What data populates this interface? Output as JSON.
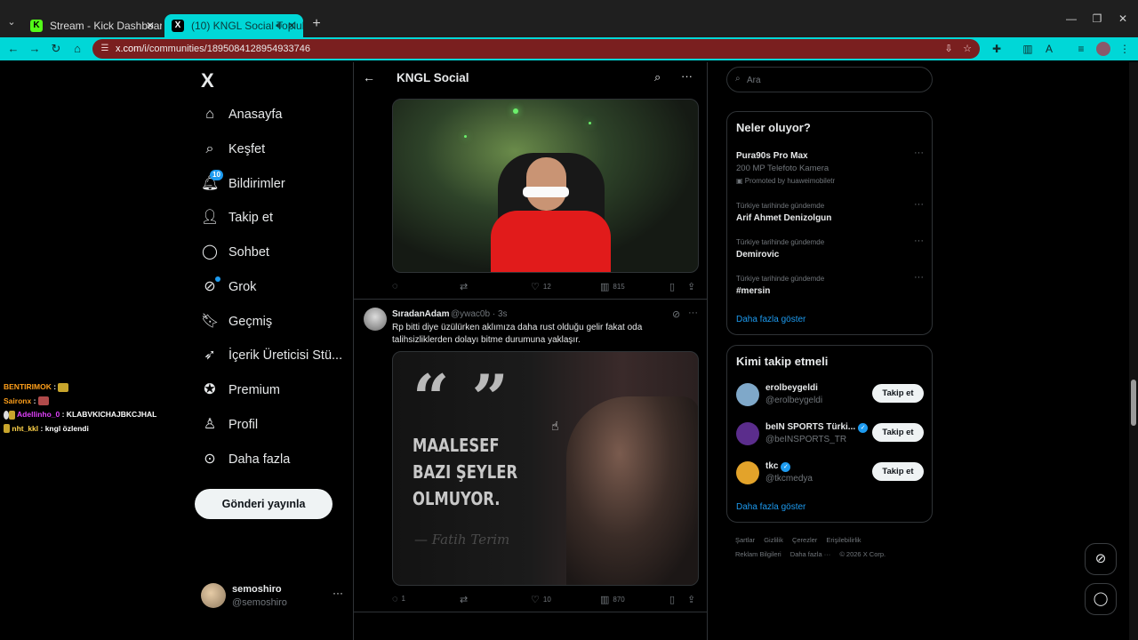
{
  "browser": {
    "tabs": [
      {
        "title": "Stream - Kick Dashboard",
        "favicon": "K",
        "active": false
      },
      {
        "title": "(10) KNGL Social Topluluk",
        "favicon": "X",
        "active": true
      }
    ],
    "url_host": "x.com",
    "url_path": "/i/communities/1895084128954933746"
  },
  "nav": {
    "logo": "X",
    "items": [
      {
        "label": "Anasayfa",
        "icon": "home-icon"
      },
      {
        "label": "Keşfet",
        "icon": "search-icon"
      },
      {
        "label": "Bildirimler",
        "icon": "bell-icon",
        "badge": "10"
      },
      {
        "label": "Takip et",
        "icon": "add-person-icon"
      },
      {
        "label": "Sohbet",
        "icon": "chat-icon"
      },
      {
        "label": "Grok",
        "icon": "grok-icon"
      },
      {
        "label": "Geçmiş",
        "icon": "bookmark-icon"
      },
      {
        "label": "İçerik Üreticisi Stü...",
        "icon": "rocket-icon"
      },
      {
        "label": "Premium",
        "icon": "premium-icon"
      },
      {
        "label": "Profil",
        "icon": "person-icon"
      },
      {
        "label": "Daha fazla",
        "icon": "more-circle-icon"
      }
    ],
    "post_button": "Gönderi yayınla",
    "account": {
      "name": "semoshiro",
      "handle": "@semoshiro"
    }
  },
  "chat_overlay": [
    {
      "user": "BENTIRIMOK",
      "msg": ":",
      "color": "#ff9f1a"
    },
    {
      "user": "Saironx",
      "msg": ":",
      "color": "#ff9f1a"
    },
    {
      "user": "Adellinho_0",
      "msg": ": KLABVKICHAJBKCJHAL",
      "color": "#e040fb"
    },
    {
      "user": "nht_kkl",
      "msg": ": kngl özlendi",
      "color": "#ffd24a"
    }
  ],
  "timeline": {
    "title": "KNGL Social",
    "tweet1": {
      "replies": "",
      "retweets": "",
      "likes": "12",
      "views": "815"
    },
    "tweet2": {
      "name": "SıradanAdam",
      "handle_time": "@ywac0b · 3s",
      "text": "Rp bitti diye üzülürken aklımıza daha rust olduğu gelir fakat oda talihsizliklerden dolayı bitme durumuna yaklaşır.",
      "image_text": {
        "quote": "“ ”",
        "lines": [
          "MAALESEF",
          "BAZI ŞEYLER",
          "OLMUYOR."
        ],
        "signature": "— Fatih Terim"
      },
      "replies": "1",
      "retweets": "",
      "likes": "10",
      "views": "870"
    }
  },
  "right": {
    "search_placeholder": "Ara",
    "trends_title": "Neler oluyor?",
    "trends": [
      {
        "title": "Pura90s Pro Max",
        "sub": "200 MP Telefoto Kamera",
        "promo": "Promoted by huaweimobiletr"
      },
      {
        "context": "Türkiye tarihinde gündemde",
        "title": "Arif Ahmet Denizolgun"
      },
      {
        "context": "Türkiye tarihinde gündemde",
        "title": "Demirovic"
      },
      {
        "context": "Türkiye tarihinde gündemde",
        "title": "#mersin"
      }
    ],
    "show_more": "Daha fazla göster",
    "wtf_title": "Kimi takip etmeli",
    "wtf": [
      {
        "name": "erolbeygeldi",
        "handle": "@erolbeygeldi",
        "verified": false,
        "avatar_color": "#7fa8c9"
      },
      {
        "name": "beIN SPORTS Türki...",
        "handle": "@beINSPORTS_TR",
        "verified": true,
        "avatar_color": "#5b2d8c"
      },
      {
        "name": "tkc",
        "handle": "@tkcmedya",
        "verified": true,
        "avatar_color": "#e3a32a"
      }
    ],
    "follow_label": "Takip et",
    "footer": [
      "Şartlar",
      "Gizlilik",
      "Çerezler",
      "Erişilebilirlik",
      "Reklam Bilgileri",
      "Daha fazla ···",
      "© 2026 X Corp."
    ]
  },
  "colors": {
    "accent": "#1d9bf0",
    "toolbar": "#00d7d7",
    "omnibox": "#7a1f1f",
    "kick": "#53fc18"
  }
}
